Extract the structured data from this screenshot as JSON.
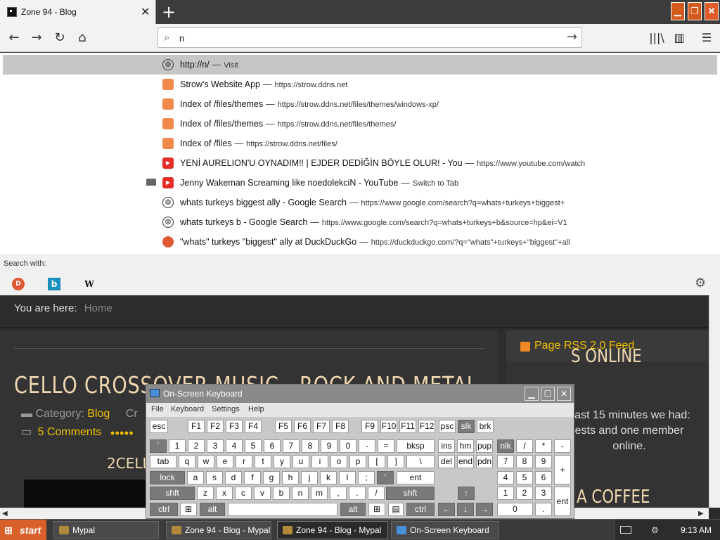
{
  "browser": {
    "tab_title": "Zone 94 - Blog",
    "tab_close": "✕",
    "new_tab": "+",
    "window": {
      "min": "▁",
      "max": "❐",
      "close": "✕"
    },
    "nav": {
      "back": "←",
      "forward": "→",
      "reload": "↻",
      "home": "⌂"
    },
    "url_value": "n",
    "url_go": "→",
    "toolbar": {
      "library": "|||\\",
      "sidebar": "▥",
      "menu": "☰"
    }
  },
  "suggestions": [
    {
      "icon": "globe-icon",
      "title": "http://n/",
      "url": "",
      "action": "Visit"
    },
    {
      "icon": "site-icon",
      "title": "Strow's Website App",
      "url": "https://strow.ddns.net",
      "action": ""
    },
    {
      "icon": "site-icon",
      "title": "Index of /files/themes",
      "url": "https://strow.ddns.net/files/themes/windows-xp/",
      "action": ""
    },
    {
      "icon": "site-icon",
      "title": "Index of /files/themes",
      "url": "https://strow.ddns.net/files/themes/",
      "action": ""
    },
    {
      "icon": "site-icon",
      "title": "Index of /files",
      "url": "https://strow.ddns.net/files/",
      "action": ""
    },
    {
      "icon": "youtube-icon",
      "title": "YENİ AURELION'U OYNADIM!! | EJDER DEDİĞİN BÖYLE OLUR! - You",
      "url": "https://www.youtube.com/watch",
      "action": ""
    },
    {
      "icon": "youtube-icon",
      "title": "Jenny Wakeman Screaming like noedolekciN - YouTube",
      "url": "",
      "action": "Switch to Tab"
    },
    {
      "icon": "globe-icon",
      "title": "whats turkeys biggest ally - Google Search",
      "url": "https://www.google.com/search?q=whats+turkeys+biggest+",
      "action": ""
    },
    {
      "icon": "globe-icon",
      "title": "whats turkeys b - Google Search",
      "url": "https://www.google.com/search?q=whats+turkeys+b&source=hp&ei=V1",
      "action": ""
    },
    {
      "icon": "duckduckgo-icon",
      "title": "\"whats\" turkeys \"biggest\" ally at DuckDuckGo",
      "url": "https://duckduckgo.com/?q=\"whats\"+turkeys+\"biggest\"+all",
      "action": ""
    }
  ],
  "separator": "—",
  "search_with": {
    "label": "Search with:",
    "engines": [
      "DuckDuckGo",
      "Bing",
      "W"
    ],
    "settings": "⚙"
  },
  "page": {
    "breadcrumb_label": "You are here:",
    "breadcrumb_home": "Home",
    "article_title": "CELLO CROSSOVER MUSIC - ROCK AND METAL",
    "category_label": "Category:",
    "category_value": "Blog",
    "category_trail": "Cr",
    "comments": "5 Comments",
    "sub_title": "2CELL",
    "rss_label": "Page RSS 2.0 Feed",
    "sidebar_heading": "S ONLINE",
    "sidebar_text": "oast 15 minutes we had: ests and one member online.",
    "sidebar_heading2": "A COFFEE"
  },
  "osk": {
    "title": "On-Screen Keyboard",
    "menu": [
      "File",
      "Keyboard",
      "Settings",
      "Help"
    ],
    "window": {
      "min": "▁",
      "max": "☐",
      "close": "✕"
    },
    "keys": {
      "esc": "esc",
      "f1": "F1",
      "f2": "F2",
      "f3": "F3",
      "f4": "F4",
      "f5": "F5",
      "f6": "F6",
      "f7": "F7",
      "f8": "F8",
      "f9": "F9",
      "f10": "F10",
      "f11": "F11",
      "f12": "F12",
      "psc": "psc",
      "slk": "slk",
      "brk": "brk",
      "backtick": "`",
      "n1": "1",
      "n2": "2",
      "n3": "3",
      "n4": "4",
      "n5": "5",
      "n6": "6",
      "n7": "7",
      "n8": "8",
      "n9": "9",
      "n0": "0",
      "minus": "-",
      "equals": "=",
      "bksp": "bksp",
      "ins": "ins",
      "hm": "hm",
      "pup": "pup",
      "nlk": "nlk",
      "slash": "/",
      "star": "*",
      "npminus": "-",
      "tab": "tab",
      "q": "q",
      "w": "w",
      "e": "e",
      "r": "r",
      "t": "t",
      "y": "y",
      "u": "u",
      "i": "i",
      "o": "o",
      "p": "p",
      "lbr": "[",
      "rbr": "]",
      "bslash": "\\",
      "del": "del",
      "end": "end",
      "pdn": "pdn",
      "np7": "7",
      "np8": "8",
      "np9": "9",
      "npplus": "+",
      "lock": "lock",
      "a": "a",
      "s": "s",
      "d": "d",
      "f": "f",
      "g": "g",
      "h": "h",
      "j": "j",
      "k": "k",
      "l": "l",
      "semi": ";",
      "quote": "'",
      "ent": "ent",
      "np4": "4",
      "np5": "5",
      "np6": "6",
      "shft": "shft",
      "z": "z",
      "x": "x",
      "c": "c",
      "v": "v",
      "b": "b",
      "n": "n",
      "m": "m",
      "comma": ",",
      "period": ".",
      "fslash": "/",
      "up": "↑",
      "np1": "1",
      "np2": "2",
      "np3": "3",
      "npent": "ent",
      "ctrl": "ctrl",
      "win": "⊞",
      "alt": "alt",
      "space": "",
      "menu": "▤",
      "left": "←",
      "down": "↓",
      "right": "→",
      "np0": "0",
      "npdot": "."
    }
  },
  "taskbar": {
    "start": "start",
    "start_flag": "⊞",
    "tasks": [
      "Mypal",
      "Zone 94 - Blog - Mypal",
      "Zone 94 - Blog - Mypal",
      "On-Screen Keyboard"
    ],
    "clock": "9:13 AM"
  },
  "colors": {
    "accent": "#d9602a",
    "link": "#f0c000",
    "heading": "#f0d9b0"
  }
}
